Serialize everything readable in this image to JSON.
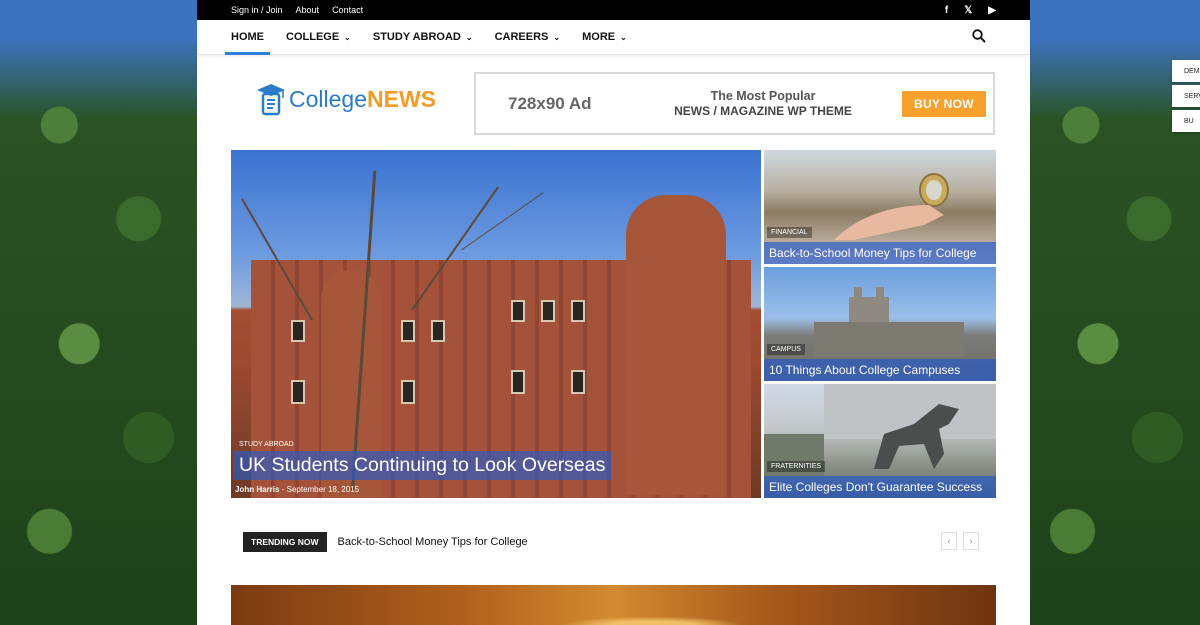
{
  "topbar": {
    "links": [
      "Sign in / Join",
      "About",
      "Contact"
    ],
    "social": [
      "facebook-icon",
      "x-icon",
      "youtube-icon"
    ],
    "social_glyphs": [
      "f",
      "𝕏",
      "▶"
    ]
  },
  "nav": {
    "items": [
      {
        "label": "HOME",
        "dropdown": false,
        "active": true
      },
      {
        "label": "COLLEGE",
        "dropdown": true
      },
      {
        "label": "STUDY ABROAD",
        "dropdown": true
      },
      {
        "label": "CAREERS",
        "dropdown": true
      },
      {
        "label": "MORE",
        "dropdown": true
      }
    ],
    "chevron": "⌄"
  },
  "logo": {
    "word1": "College",
    "word2": "NEWS"
  },
  "ad": {
    "size": "728x90 Ad",
    "line1": "The Most Popular",
    "line2": "NEWS / MAGAZINE WP THEME",
    "button": "BUY NOW"
  },
  "featured": {
    "category": "STUDY ABROAD",
    "title": "UK Students Continuing to Look Overseas",
    "author": "John Harris",
    "separator": "-",
    "date": "September 18, 2015"
  },
  "side_posts": [
    {
      "category": "FINANCIAL",
      "title": "Back-to-School Money Tips for College"
    },
    {
      "category": "CAMPUS",
      "title": "10 Things About College Campuses"
    },
    {
      "category": "FRATERNITIES",
      "title": "Elite Colleges Don't Guarantee Success"
    }
  ],
  "trending": {
    "label": "TRENDING NOW",
    "headline": "Back-to-School Money Tips for College",
    "prev": "‹",
    "next": "›"
  },
  "side_buttons": [
    "DEM",
    "SERV",
    "BU"
  ],
  "colors": {
    "accent": "#2e80d6",
    "logo_blue": "#2b7bc8",
    "logo_orange": "#f29c25",
    "buy_button": "#f6a12e"
  }
}
